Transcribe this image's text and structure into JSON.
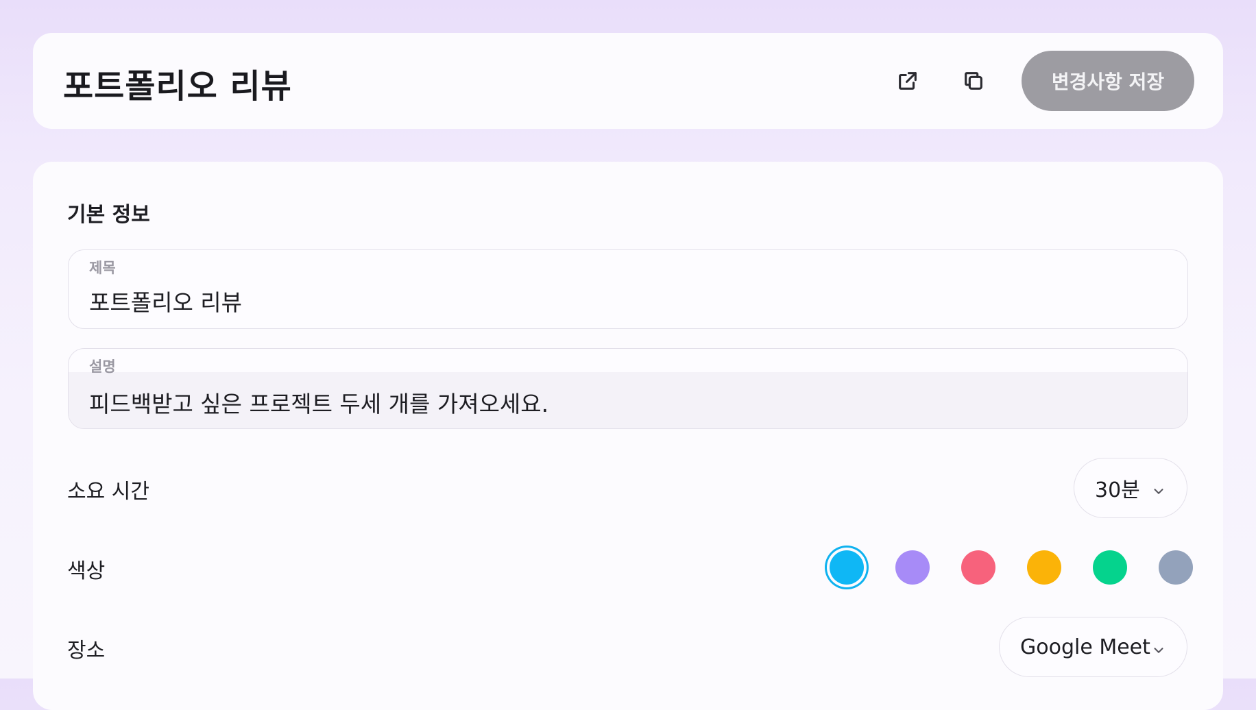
{
  "header": {
    "title": "포트폴리오 리뷰",
    "save_label": "변경사항 저장"
  },
  "basic_info": {
    "section_title": "기본 정보",
    "title_field": {
      "label": "제목",
      "value": "포트폴리오 리뷰"
    },
    "description_field": {
      "label": "설명",
      "value": "피드백받고 싶은 프로젝트 두세 개를 가져오세요."
    },
    "duration": {
      "label": "소요 시간",
      "value": "30분"
    },
    "color": {
      "label": "색상",
      "options": [
        "#0fb7f5",
        "#a78bf7",
        "#f7627c",
        "#fbb308",
        "#05d38d",
        "#93a2bb"
      ],
      "selected_index": 0
    },
    "location": {
      "label": "장소",
      "value": "Google Meet"
    }
  }
}
